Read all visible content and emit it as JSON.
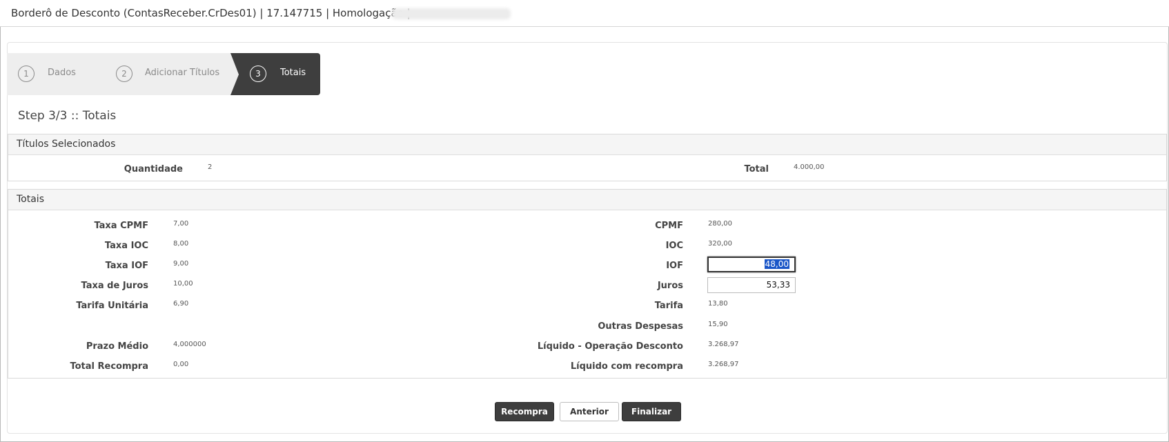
{
  "window": {
    "title": "Borderô de Desconto (ContasReceber.CrDes01) | 17.147715 | Homologação |"
  },
  "wizard": {
    "steps": [
      {
        "num": "1",
        "label": "Dados"
      },
      {
        "num": "2",
        "label": "Adicionar Títulos"
      },
      {
        "num": "3",
        "label": "Totais"
      }
    ],
    "active_step": 3
  },
  "step_title": "Step 3/3 :: Totais",
  "titulos_selecionados": {
    "header": "Títulos Selecionados",
    "quantidade_label": "Quantidade",
    "quantidade_value": "2",
    "total_label": "Total",
    "total_value": "4.000,00"
  },
  "totais": {
    "header": "Totais",
    "left": [
      {
        "label": "Taxa CPMF",
        "value": "7,00"
      },
      {
        "label": "Taxa IOC",
        "value": "8,00"
      },
      {
        "label": "Taxa IOF",
        "value": "9,00"
      },
      {
        "label": "Taxa de Juros",
        "value": "10,00"
      },
      {
        "label": "Tarifa Unitária",
        "value": "6,90"
      },
      {
        "label": "Prazo Médio",
        "value": "4,000000"
      },
      {
        "label": "Total Recompra",
        "value": "0,00"
      }
    ],
    "right": [
      {
        "label": "CPMF",
        "value": "280,00"
      },
      {
        "label": "IOC",
        "value": "320,00"
      },
      {
        "label": "IOF",
        "value": "48,00"
      },
      {
        "label": "Juros",
        "value": "53,33"
      },
      {
        "label": "Tarifa",
        "value": "13,80"
      },
      {
        "label": "Outras Despesas",
        "value": "15,90"
      },
      {
        "label": "Líquido - Operação Desconto",
        "value": "3.268,97"
      },
      {
        "label": "Líquido com recompra",
        "value": "3.268,97"
      }
    ]
  },
  "buttons": {
    "recompra": "Recompra",
    "anterior": "Anterior",
    "finalizar": "Finalizar"
  },
  "colors": {
    "dark": "#3e3e3e",
    "selection": "#1a56c8"
  }
}
